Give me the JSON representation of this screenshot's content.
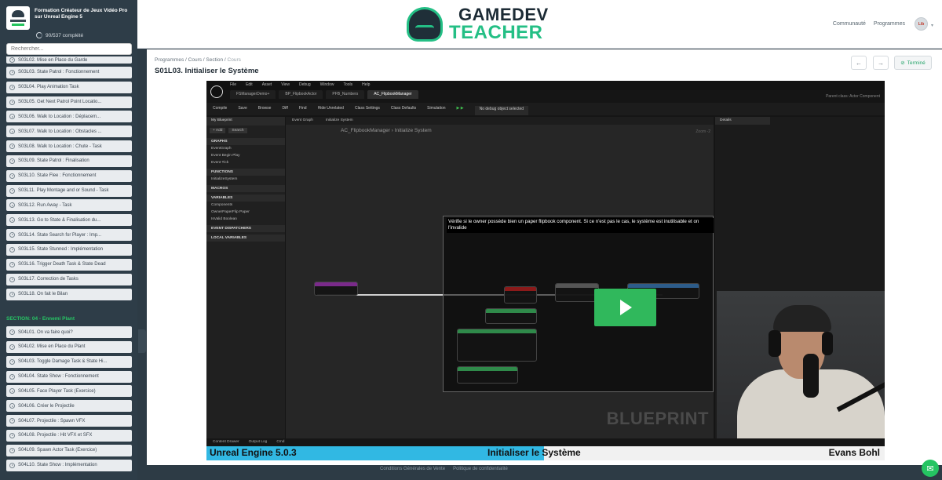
{
  "sidebar": {
    "course_title": "Formation Créateur de Jeux Vidéo Pro sur Unreal Engine 5",
    "progress": "90/537 complété",
    "search_placeholder": "Rechercher...",
    "lessons_top": [
      "S03L02. Mise en Place du Garde",
      "S03L03. State Patrol : Fonctionnement",
      "S03L04. Play Animation Task",
      "S03L05. Get Next Patrol Point Locatio...",
      "S03L06. Walk to Location : Déplacem...",
      "S03L07. Walk to Location : Obstacles ...",
      "S03L08. Walk to Location : Chute - Task",
      "S03L09. State Patrol : Finalisation",
      "S03L10. State Flee : Fonctionnement",
      "S03L11. Play Montage and or Sound - Task",
      "S03L12. Run Away - Task",
      "S03L13. Go to State & Finalisation du...",
      "S03L14. State Search for Player : Imp...",
      "S03L15. State Stunned : Implémentation",
      "S03L16. Trigger Death Task & State Dead",
      "S03L17. Correction de Tasks",
      "S03L18. On fait le Bilan"
    ],
    "section_label": "SECTION: 04 - Ennemi Plant",
    "lessons_bottom": [
      "S04L01. On va faire quoi?",
      "S04L02. Mise en Place du Plant",
      "S04L03. Toggle Damage Task & State Hi...",
      "S04L04. State Show : Fonctionnement",
      "S04L05. Face Player Task (Exercice)",
      "S04L06. Créer le Projectile",
      "S04L07. Projectile : Spawn VFX",
      "S04L08. Projectile : Hit VFX et SFX",
      "S04L09. Spawn Actor Task (Exercice)",
      "S04L10. State Show : Implémentation"
    ]
  },
  "header": {
    "brand_line1": "GAMEDEV",
    "brand_line2": "TEACHER",
    "nav": [
      "Communauté",
      "Programmes"
    ],
    "avatar_initials": "Lib"
  },
  "main": {
    "breadcrumb": [
      "Programmes",
      "Cours",
      "Section"
    ],
    "breadcrumb_current": "Cours",
    "title": "S01L03. Initialiser le Système",
    "done_label": "Terminé"
  },
  "video": {
    "menu": [
      "File",
      "Edit",
      "Asset",
      "View",
      "Debug",
      "Window",
      "Tools",
      "Help"
    ],
    "tabs": [
      "FSManagerDemo+",
      "BP_FlipbookActor",
      "PFB_Numbers",
      "AC_FlipbookManager"
    ],
    "parent_class": "Parent class: Actor Component",
    "toolbar": [
      "Compile",
      "Save",
      "Browse",
      "Diff",
      "Find",
      "Hide Unrelated",
      "Class Settings",
      "Class Defaults",
      "Simulation"
    ],
    "debug_select": "No debug object selected",
    "mybp_title": "My Blueprint",
    "mybp_add": "+ Add",
    "mybp_search": "Search",
    "mybp_rows": [
      {
        "text": "GRAPHS",
        "hdr": true
      },
      {
        "text": "EventGraph",
        "hdr": false
      },
      {
        "text": "Event Begin Play",
        "hdr": false
      },
      {
        "text": "Event Tick",
        "hdr": false
      },
      {
        "text": "FUNCTIONS",
        "hdr": true
      },
      {
        "text": "InitializeSystem",
        "hdr": false
      },
      {
        "text": "MACROS",
        "hdr": true
      },
      {
        "text": "VARIABLES",
        "hdr": true
      },
      {
        "text": "Components",
        "hdr": false
      },
      {
        "text": "OwnerPaperFlip  Paper",
        "hdr": false
      },
      {
        "text": "IsValid  Boolean",
        "hdr": false
      },
      {
        "text": "EVENT DISPATCHERS",
        "hdr": true
      },
      {
        "text": "LOCAL VARIABLES",
        "hdr": true
      }
    ],
    "graph_tabs": [
      "Event Graph",
      "Initialize System"
    ],
    "graph_crumb": "AC_FlipbookManager  ›  Initialize System",
    "zoom": "Zoom -2",
    "note": "Vérifie si le owner possède bien un paper flipbook component. Si ce n'est pas le cas, le système est inutilisable et on l'invalide",
    "watermark": "BLUEPRINT",
    "details_tab": "Details",
    "statusbar": [
      "Content Drawer",
      "Output Log",
      "Cmd"
    ],
    "caption_course": "Unreal Engine 5.0.3",
    "caption_lesson": "Initialiser le Système",
    "caption_author": "Evans Bohl"
  },
  "footer": [
    "Conditions Générales de Vente",
    "Politique de confidentialité"
  ],
  "colors": {
    "accent_green": "#25c462",
    "brand_teal": "#24bf85",
    "caption_blue": "#31b8e3",
    "sidebar_bg": "#2e3d48"
  }
}
